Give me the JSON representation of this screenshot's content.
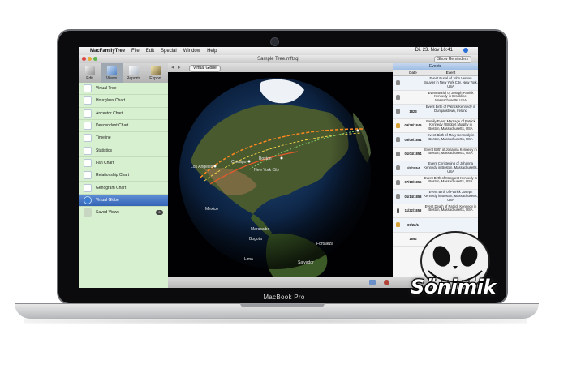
{
  "menubar": {
    "app": "MacFamilyTree",
    "items": [
      "File",
      "Edit",
      "Special",
      "Window",
      "Help"
    ],
    "clock": "Di. 23. Nov 16:41"
  },
  "window": {
    "title": "Sample Tree.mftsql",
    "show_reminders": "Show Reminders",
    "toolbar": [
      {
        "label": "Edit",
        "icon": "edit-icon"
      },
      {
        "label": "Views",
        "icon": "views-icon"
      },
      {
        "label": "Reports",
        "icon": "reports-icon"
      },
      {
        "label": "Export",
        "icon": "export-icon"
      }
    ],
    "breadcrumb": "Virtual Globe"
  },
  "sidebar": {
    "items": [
      {
        "label": "Virtual Tree",
        "icon": "tree-icon"
      },
      {
        "label": "Hourglass Chart",
        "icon": "hourglass-icon"
      },
      {
        "label": "Ancestor Chart",
        "icon": "ancestor-chart-icon"
      },
      {
        "label": "Descendant Chart",
        "icon": "descendant-chart-icon"
      },
      {
        "label": "Timeline",
        "icon": "timeline-icon"
      },
      {
        "label": "Statistics",
        "icon": "statistics-icon"
      },
      {
        "label": "Fan Chart",
        "icon": "fan-chart-icon"
      },
      {
        "label": "Relationship Chart",
        "icon": "relationship-chart-icon"
      },
      {
        "label": "Genogram Chart",
        "icon": "genogram-icon"
      },
      {
        "label": "Virtual Globe",
        "icon": "globe-icon",
        "selected": true
      }
    ],
    "saved_views": "Saved Views",
    "saved_count": "0"
  },
  "globe": {
    "labels": [
      "Los Angeles",
      "Chicago",
      "Boston",
      "New York City",
      "Mexico",
      "Maracaibo",
      "Bogota",
      "Fortaleza",
      "Lima",
      "Salvador"
    ]
  },
  "events": {
    "title": "Events",
    "columns": [
      "Date",
      "Event"
    ],
    "rows": [
      {
        "date": "",
        "text": "Event Burial of John Vernou Bouvier in New York City, New York, USA"
      },
      {
        "date": "",
        "text": "Event Burial of Joseph Patrick Kennedy in Brookline, Massachusetts, USA"
      },
      {
        "date": "1823",
        "text": "Event Birth of Patrick Kennedy in Dunganstown, Ireland"
      },
      {
        "date": "09/28/1849",
        "text": "Family Event Marriage of Patrick Kennedy / Bridget Murphy in Boston, Massachusetts, USA"
      },
      {
        "date": "08/09/1851",
        "text": "Event Birth of Mary Kennedy in Boston, Massachusetts, USA"
      },
      {
        "date": "01/04/1854",
        "text": "Event Birth of Johanna Kennedy in Boston, Massachusetts, USA"
      },
      {
        "date": "1/5/1854",
        "text": "Event Christening of Johanna Kennedy in Boston, Massachusetts, USA"
      },
      {
        "date": "07/18/1855",
        "text": "Event Birth of Margaret Kennedy in Boston, Massachusetts, USA"
      },
      {
        "date": "01/14/1858",
        "text": "Event Birth of Patrick Joseph Kennedy in Boston, Massachusetts, USA"
      },
      {
        "date": "11/22/1858",
        "text": "Event Death of Patrick Kennedy in Boston, Massachusetts, USA"
      },
      {
        "date": "09/22/1",
        "text": ""
      },
      {
        "date": "1892",
        "text": ""
      }
    ]
  },
  "device": {
    "label": "MacBook Pro"
  },
  "watermark": {
    "text": "Sönimik"
  }
}
